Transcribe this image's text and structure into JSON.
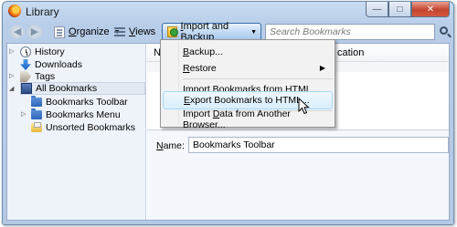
{
  "window": {
    "title": "Library"
  },
  "toolbar": {
    "organize": {
      "pre": "",
      "ul": "O",
      "post": "rganize"
    },
    "views": {
      "pre": "",
      "ul": "V",
      "post": "iews"
    },
    "import_backup": {
      "pre": "",
      "ul": "I",
      "post": "mport and Backup"
    },
    "search": {
      "placeholder": "Search Bookmarks"
    }
  },
  "sidebar": {
    "items": [
      {
        "label": "History"
      },
      {
        "label": "Downloads"
      },
      {
        "label": "Tags"
      },
      {
        "label": "All Bookmarks",
        "selected": true
      },
      {
        "label": "Bookmarks Toolbar"
      },
      {
        "label": "Bookmarks Menu"
      },
      {
        "label": "Unsorted Bookmarks"
      }
    ]
  },
  "main": {
    "columns": {
      "name": "Na",
      "location": "cation"
    },
    "details": {
      "name_label": {
        "pre": "",
        "ul": "N",
        "post": "ame:"
      },
      "name_value": "Bookmarks Toolbar"
    }
  },
  "menu": {
    "items": [
      {
        "pre": "",
        "ul": "B",
        "post": "ackup..."
      },
      {
        "pre": "",
        "ul": "R",
        "post": "estore",
        "submenu": true
      },
      {
        "pre": "Import Bookmarks from ",
        "ul": "H",
        "post": "TML..."
      },
      {
        "pre": "",
        "ul": "E",
        "post": "xport Bookmarks to HTML...",
        "highlighted": true
      },
      {
        "pre": "Import ",
        "ul": "D",
        "post": "ata from Another Browser..."
      }
    ]
  },
  "colors": {
    "titlebar": "#c9dcf1",
    "highlight": "#d9eefc",
    "sidebar": "#eef3fa"
  },
  "icons": [
    "firefox-icon",
    "back-icon",
    "forward-icon",
    "organize-icon",
    "views-icon",
    "import-backup-icon",
    "search-icon",
    "history-icon",
    "downloads-icon",
    "tags-icon",
    "all-bookmarks-icon",
    "folder-icon",
    "unsorted-bookmarks-icon",
    "mouse-pointer-icon"
  ]
}
